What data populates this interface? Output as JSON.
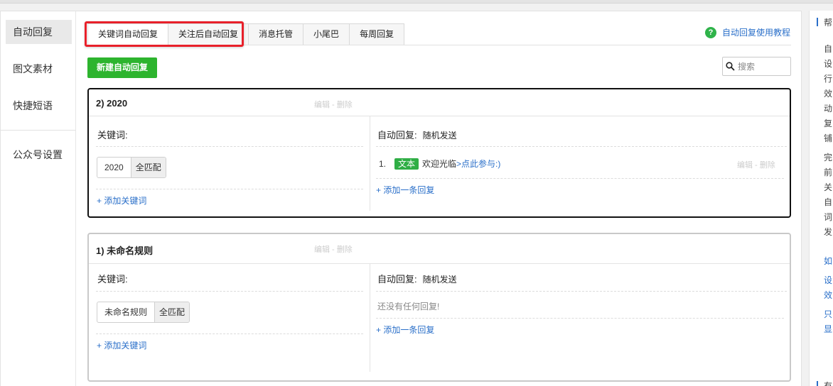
{
  "sidebar": {
    "items": [
      {
        "label": "自动回复"
      },
      {
        "label": "图文素材"
      },
      {
        "label": "快捷短语"
      },
      {
        "label": "公众号设置"
      }
    ]
  },
  "tabs": [
    {
      "label": "关键词自动回复"
    },
    {
      "label": "关注后自动回复"
    },
    {
      "label": "消息托管"
    },
    {
      "label": "小尾巴"
    },
    {
      "label": "每周回复"
    }
  ],
  "help_link": {
    "icon": "question-icon",
    "label": "自动回复使用教程"
  },
  "new_button": {
    "label": "新建自动回复"
  },
  "search": {
    "placeholder": "搜索"
  },
  "rules": [
    {
      "title": "2) 2020",
      "ops": "编辑 - 删除",
      "keyword_label": "关键词:",
      "keywords": [
        {
          "text": "2020",
          "mode": "全匹配"
        }
      ],
      "add_keyword": "+ 添加关键词",
      "reply_label": "自动回复:",
      "reply_mode": "随机发送",
      "replies": [
        {
          "index": "1.",
          "type": "文本",
          "text": "欢迎光临 ",
          "link": ">点此参与:)",
          "ops": "编辑 - 删除"
        }
      ],
      "add_reply": "+ 添加一条回复"
    },
    {
      "title": "1) 未命名规则",
      "ops": "编辑 - 删除",
      "keyword_label": "关键词:",
      "keywords": [
        {
          "text": "未命名规则",
          "mode": "全匹配"
        }
      ],
      "add_keyword": "+ 添加关键词",
      "reply_label": "自动回复:",
      "reply_mode": "随机发送",
      "empty_text": "还没有任何回复!",
      "add_reply": "+ 添加一条回复"
    }
  ],
  "help_panel": {
    "title": "帮",
    "lines": [
      "自",
      "设",
      "行",
      "效",
      "动",
      "复",
      "铺",
      "完",
      "前",
      "关",
      "自",
      "词",
      "发",
      "如",
      "设",
      "效",
      "只",
      "显",
      "有"
    ]
  },
  "colors": {
    "accent_green": "#2db42e",
    "link_blue": "#2a6fc9",
    "highlight_red": "#e8202a"
  }
}
